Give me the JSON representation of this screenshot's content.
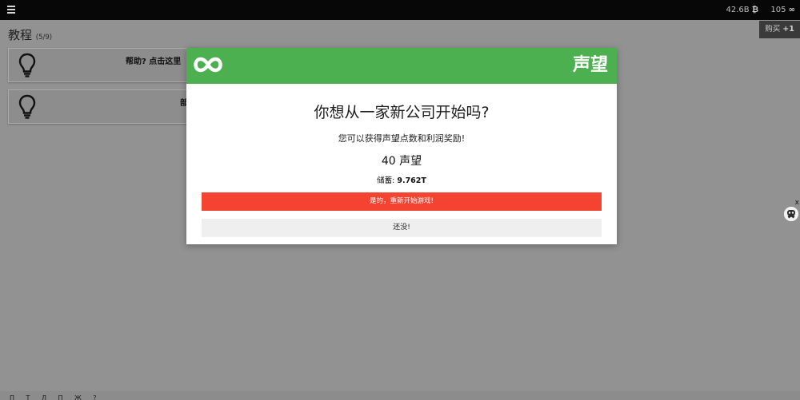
{
  "topbar": {
    "btc_amount": "42.6B",
    "btc_glyph": "₿",
    "prestige_amount": "105",
    "prestige_glyph": "∞"
  },
  "buy_button": {
    "label": "购买",
    "quantity": "+1"
  },
  "tutorial": {
    "title": "教程",
    "progress": "(5/9)",
    "tips": [
      {
        "text": "帮助?  点击这里"
      },
      {
        "text": "部"
      }
    ]
  },
  "modal": {
    "title": "声望",
    "question": "你想从一家新公司开始吗?",
    "description": "您可以获得声望点数和利润奖励!",
    "points_reward": "40 声望",
    "savings_label": "储蓄:",
    "savings_value": "9.762T",
    "restart_label": "是的，重新开始游戏!",
    "not_yet_label": "还没!"
  },
  "side_widget": {
    "close_glyph": "x"
  },
  "bottom_strip": {
    "glyphs": "П Т Л П Ж ?"
  },
  "colors": {
    "header_green": "#4caf50",
    "restart_red": "#f44331",
    "topbar_black": "#070707"
  }
}
